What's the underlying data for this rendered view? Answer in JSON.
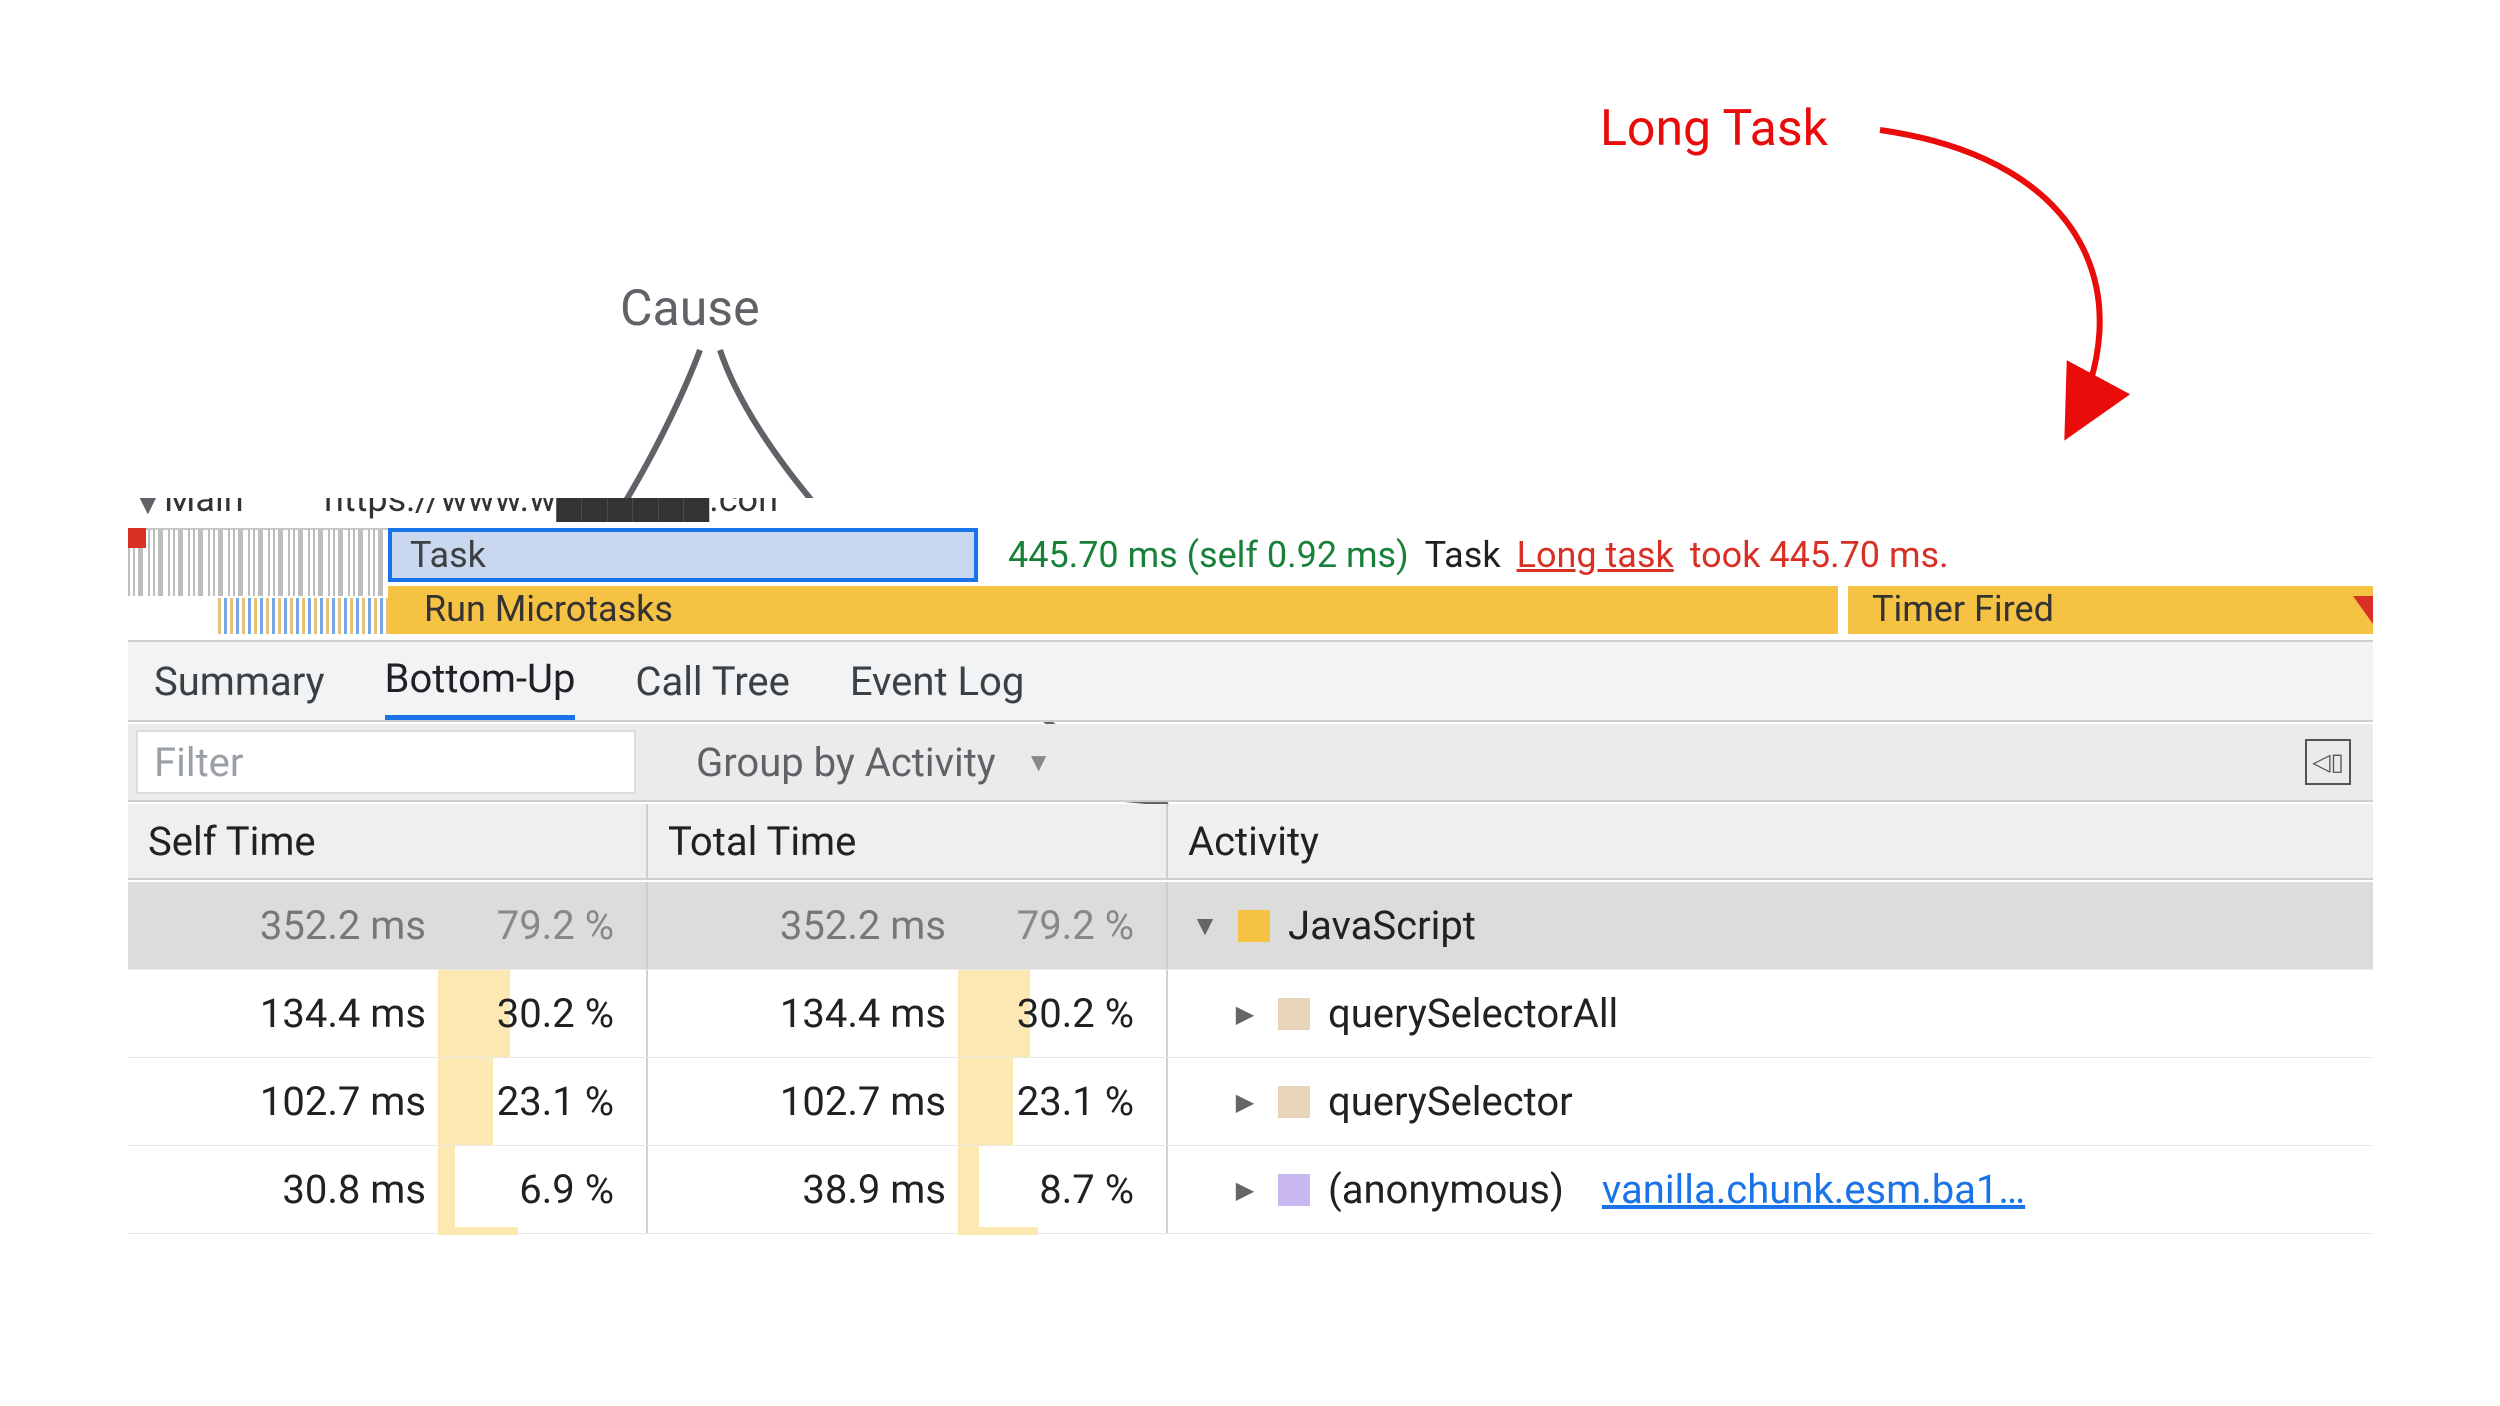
{
  "annotations": {
    "long_task": "Long Task",
    "cause": "Cause"
  },
  "flame": {
    "main_label": "Main",
    "url_partial": "https://www.w██████.con",
    "task_label": "Task",
    "task_time_green": "445.70 ms (self 0.92 ms)",
    "task_word": "Task",
    "long_task_link": "Long task",
    "long_task_suffix": "took 445.70 ms.",
    "microtasks_partial": "Run Microtasks",
    "timer_fired_partial": "Timer Fired"
  },
  "tabs": {
    "summary": "Summary",
    "bottom_up": "Bottom-Up",
    "call_tree": "Call Tree",
    "event_log": "Event Log"
  },
  "filter": {
    "placeholder": "Filter",
    "group_by": "Group by Activity"
  },
  "headers": {
    "self_time": "Self Time",
    "total_time": "Total Time",
    "activity": "Activity"
  },
  "rows": [
    {
      "self_time": "352.2 ms",
      "self_pct": "79.2 %",
      "self_bar": 100,
      "total_time": "352.2 ms",
      "total_pct": "79.2 %",
      "total_bar": 100,
      "expand": "down",
      "color": "yellow",
      "activity": "JavaScript",
      "link": "",
      "faded": true,
      "selected": true
    },
    {
      "self_time": "134.4 ms",
      "self_pct": "30.2 %",
      "self_bar": 38,
      "total_time": "134.4 ms",
      "total_pct": "30.2 %",
      "total_bar": 38,
      "expand": "right",
      "color": "tan",
      "activity": "querySelectorAll",
      "link": "",
      "faded": false,
      "selected": false
    },
    {
      "self_time": "102.7 ms",
      "self_pct": "23.1 %",
      "self_bar": 29,
      "total_time": "102.7 ms",
      "total_pct": "23.1 %",
      "total_bar": 29,
      "expand": "right",
      "color": "tan",
      "activity": "querySelector",
      "link": "",
      "faded": false,
      "selected": false
    },
    {
      "self_time": "30.8 ms",
      "self_pct": "6.9 %",
      "self_bar": 9,
      "total_time": "38.9 ms",
      "total_pct": "8.7 %",
      "total_bar": 11,
      "expand": "right",
      "color": "lav",
      "activity": "(anonymous)",
      "link": "vanilla.chunk.esm.ba1…",
      "faded": false,
      "selected": false
    }
  ]
}
